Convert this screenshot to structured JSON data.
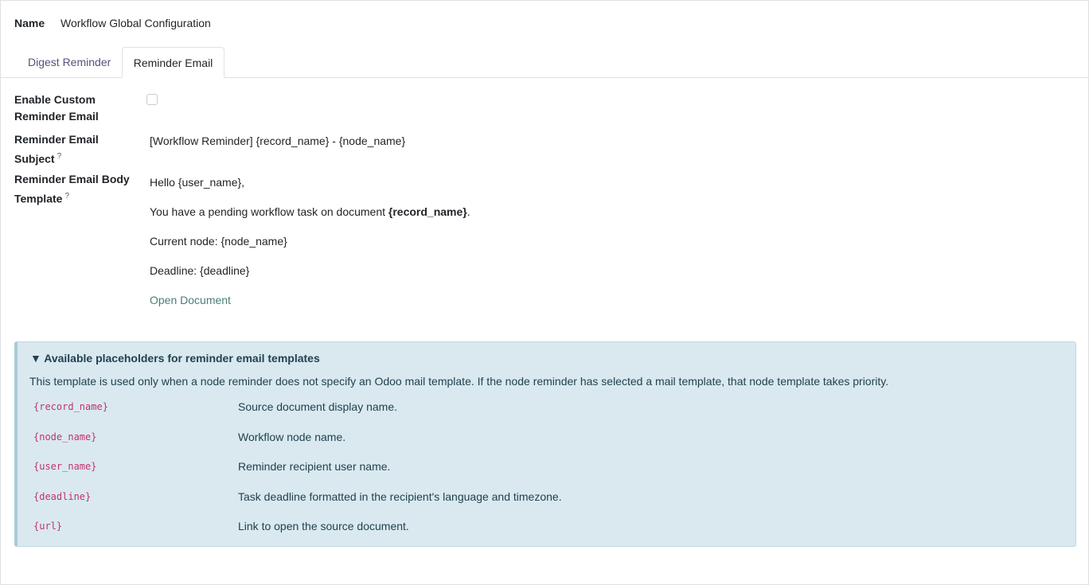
{
  "form": {
    "name_label": "Name",
    "name_value": "Workflow Global Configuration"
  },
  "tabs": [
    {
      "label": "Digest Reminder",
      "active": false
    },
    {
      "label": "Reminder Email",
      "active": true
    }
  ],
  "fields": {
    "enable_label": "Enable Custom Reminder Email",
    "enable_checked": false,
    "subject_label": "Reminder Email Subject",
    "subject_help": "?",
    "subject_value": "[Workflow Reminder] {record_name} - {node_name}",
    "body_label": "Reminder Email Body Template",
    "body_help": "?"
  },
  "body_template": {
    "greeting": "Hello {user_name},",
    "task_prefix": "You have a pending workflow task on document ",
    "task_record": "{record_name}",
    "task_suffix": ".",
    "node_line": "Current node: {node_name}",
    "deadline_line": "Deadline: {deadline}",
    "open_link": "Open Document"
  },
  "placeholders": {
    "title": "▼ Available placeholders for reminder email templates",
    "description": "This template is used only when a node reminder does not specify an Odoo mail template. If the node reminder has selected a mail template, that node template takes priority.",
    "rows": [
      {
        "code": "{record_name}",
        "desc": "Source document display name."
      },
      {
        "code": "{node_name}",
        "desc": "Workflow node name."
      },
      {
        "code": "{user_name}",
        "desc": "Reminder recipient user name."
      },
      {
        "code": "{deadline}",
        "desc": "Task deadline formatted in the recipient's language and timezone."
      },
      {
        "code": "{url}",
        "desc": "Link to open the source document."
      }
    ]
  },
  "colors": {
    "accent": "#5a4f7c",
    "link": "#4d7d7a",
    "alert_bg": "#d9e9ef",
    "code": "#c0336b"
  }
}
